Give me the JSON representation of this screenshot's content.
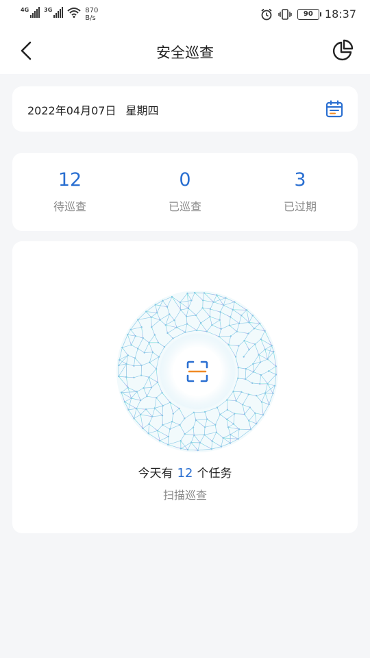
{
  "status_bar": {
    "net1": "4G",
    "net2": "3G",
    "speed_value": "870",
    "speed_unit": "B/s",
    "battery": "90",
    "time": "18:37"
  },
  "header": {
    "title": "安全巡查",
    "back_icon": "chevron-left-icon",
    "stats_icon": "pie-chart-icon"
  },
  "date_bar": {
    "date": "2022年04月07日",
    "weekday": "星期四",
    "calendar_icon": "calendar-icon"
  },
  "stats": [
    {
      "count": "12",
      "label": "待巡查"
    },
    {
      "count": "0",
      "label": "已巡查"
    },
    {
      "count": "3",
      "label": "已过期"
    }
  ],
  "scan": {
    "prefix": "今天有",
    "count": "12",
    "suffix": "个任务",
    "action_label": "扫描巡查",
    "icon": "scan-icon"
  },
  "colors": {
    "accent": "#2a6fd1",
    "scan_line": "#f08a24",
    "globe_top": "#5fe3d2",
    "globe_bottom": "#a08ae0"
  }
}
